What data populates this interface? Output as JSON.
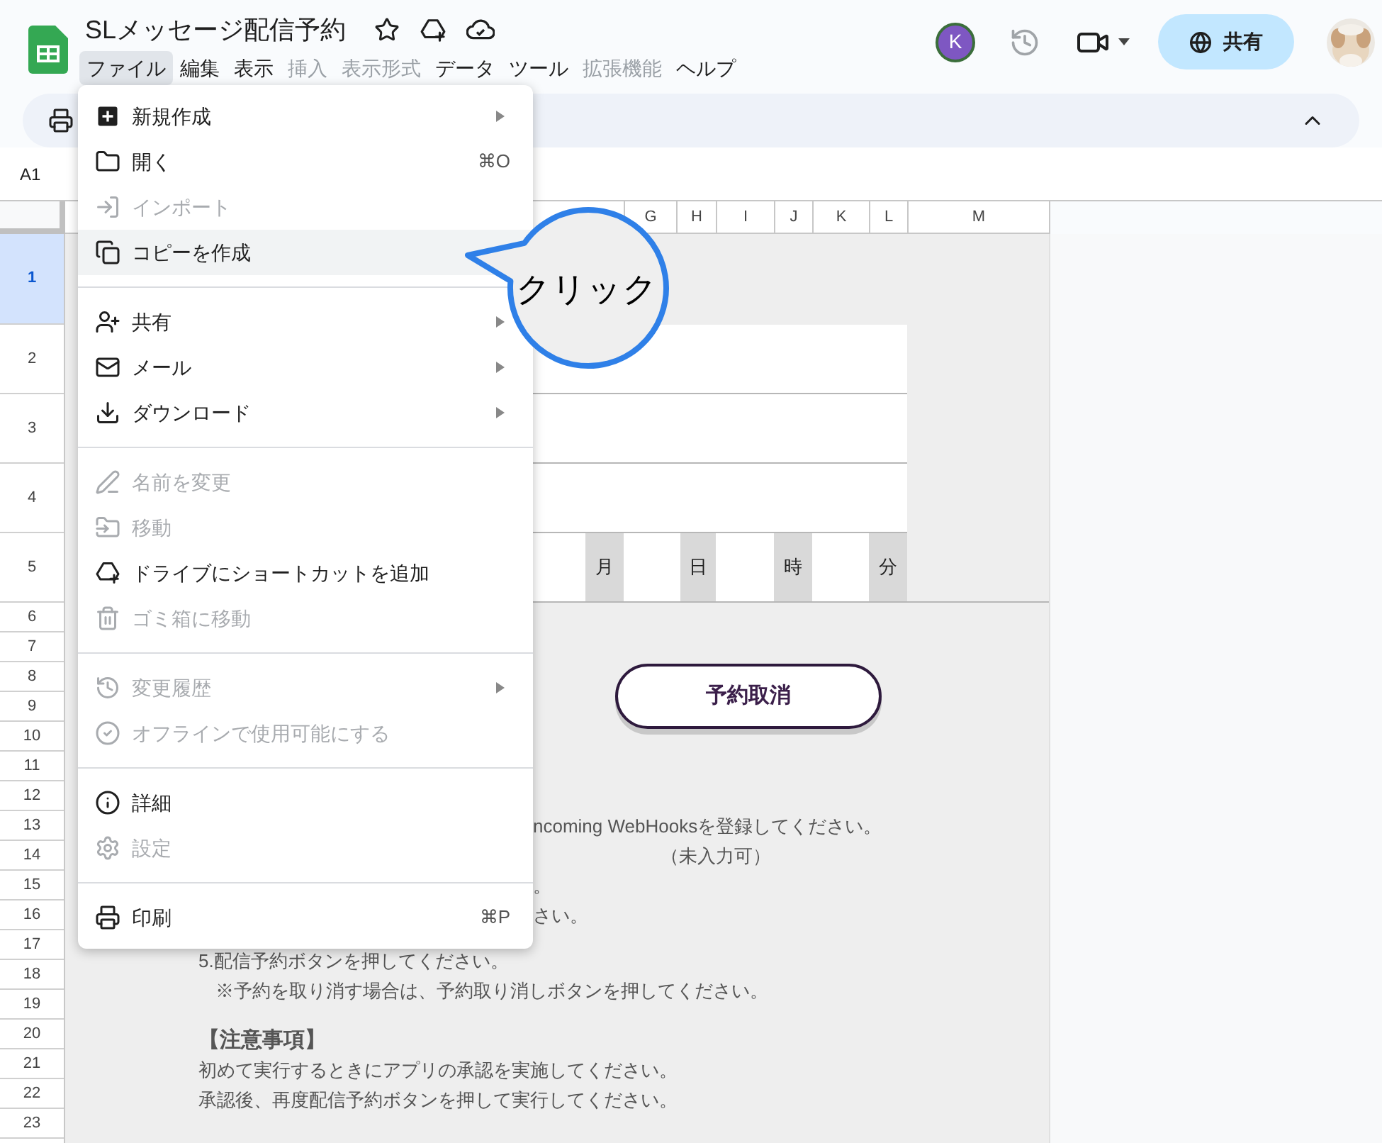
{
  "document": {
    "title": "SLメッセージ配信予約"
  },
  "menubar": [
    {
      "label": "ファイル",
      "selected": true,
      "disabled": false
    },
    {
      "label": "編集",
      "selected": false,
      "disabled": false
    },
    {
      "label": "表示",
      "selected": false,
      "disabled": false
    },
    {
      "label": "挿入",
      "selected": false,
      "disabled": true
    },
    {
      "label": "表示形式",
      "selected": false,
      "disabled": true
    },
    {
      "label": "データ",
      "selected": false,
      "disabled": false
    },
    {
      "label": "ツール",
      "selected": false,
      "disabled": false
    },
    {
      "label": "拡張機能",
      "selected": false,
      "disabled": true
    },
    {
      "label": "ヘルプ",
      "selected": false,
      "disabled": false
    }
  ],
  "account": {
    "avatar_letter": "K"
  },
  "share_button": {
    "label": "共有"
  },
  "name_box": {
    "value": "A1"
  },
  "sheet": {
    "columns": [
      "G",
      "H",
      "I",
      "J",
      "K",
      "L",
      "M"
    ],
    "rows": [
      {
        "label": "1",
        "selected": true
      },
      {
        "label": "2",
        "selected": false
      },
      {
        "label": "3",
        "selected": false
      },
      {
        "label": "4",
        "selected": false
      },
      {
        "label": "5",
        "selected": false
      },
      {
        "label": "6",
        "selected": false
      },
      {
        "label": "7",
        "selected": false
      },
      {
        "label": "8",
        "selected": false
      },
      {
        "label": "9",
        "selected": false
      },
      {
        "label": "10",
        "selected": false
      },
      {
        "label": "11",
        "selected": false
      },
      {
        "label": "12",
        "selected": false
      },
      {
        "label": "13",
        "selected": false
      },
      {
        "label": "14",
        "selected": false
      },
      {
        "label": "15",
        "selected": false
      },
      {
        "label": "16",
        "selected": false
      },
      {
        "label": "17",
        "selected": false
      },
      {
        "label": "18",
        "selected": false
      },
      {
        "label": "19",
        "selected": false
      },
      {
        "label": "20",
        "selected": false
      },
      {
        "label": "21",
        "selected": false
      },
      {
        "label": "22",
        "selected": false
      },
      {
        "label": "23",
        "selected": false
      }
    ],
    "date_units": [
      "月",
      "日",
      "時",
      "分"
    ],
    "cancel_button": {
      "label": "予約取消"
    },
    "lines": [
      {
        "kind": "clipped",
        "text": "ncoming WebHooksを登録してください。"
      },
      {
        "kind": "clipped-far",
        "text": "（未入力可）"
      },
      {
        "kind": "clipped",
        "text": "。"
      },
      {
        "kind": "clipped",
        "text": "さい。"
      },
      {
        "kind": "body",
        "text": "5.配信予約ボタンを押してください。"
      },
      {
        "kind": "note",
        "text": "※予約を取り消す場合は、予約取り消しボタンを押してください。"
      },
      {
        "kind": "heading",
        "text": "【注意事項】"
      },
      {
        "kind": "body",
        "text": "初めて実行するときにアプリの承認を実施してください。"
      },
      {
        "kind": "body",
        "text": "承認後、再度配信予約ボタンを押して実行してください。"
      }
    ]
  },
  "file_menu": {
    "sections": [
      {
        "items": [
          {
            "label": "新規作成",
            "selected": false,
            "disabled": false,
            "submenu": true
          },
          {
            "label": "開く",
            "selected": false,
            "disabled": false,
            "submenu": false,
            "shortcut": "⌘O"
          },
          {
            "label": "インポート",
            "selected": false,
            "disabled": true,
            "submenu": false
          },
          {
            "label": "コピーを作成",
            "selected": true,
            "disabled": false,
            "submenu": false
          }
        ]
      },
      {
        "items": [
          {
            "label": "共有",
            "selected": false,
            "disabled": false,
            "submenu": true
          },
          {
            "label": "メール",
            "selected": false,
            "disabled": false,
            "submenu": true
          },
          {
            "label": "ダウンロード",
            "selected": false,
            "disabled": false,
            "submenu": true
          }
        ]
      },
      {
        "items": [
          {
            "label": "名前を変更",
            "selected": false,
            "disabled": true,
            "submenu": false
          },
          {
            "label": "移動",
            "selected": false,
            "disabled": true,
            "submenu": false
          },
          {
            "label": "ドライブにショートカットを追加",
            "selected": false,
            "disabled": false,
            "submenu": false
          },
          {
            "label": "ゴミ箱に移動",
            "selected": false,
            "disabled": true,
            "submenu": false
          }
        ]
      },
      {
        "items": [
          {
            "label": "変更履歴",
            "selected": false,
            "disabled": true,
            "submenu": true
          },
          {
            "label": "オフラインで使用可能にする",
            "selected": false,
            "disabled": true,
            "submenu": false
          }
        ]
      },
      {
        "items": [
          {
            "label": "詳細",
            "selected": false,
            "disabled": false,
            "submenu": false
          },
          {
            "label": "設定",
            "selected": false,
            "disabled": true,
            "submenu": false
          }
        ]
      },
      {
        "items": [
          {
            "label": "印刷",
            "selected": false,
            "disabled": false,
            "submenu": false,
            "shortcut": "⌘P"
          }
        ]
      }
    ]
  },
  "callout": {
    "text": "クリック"
  }
}
